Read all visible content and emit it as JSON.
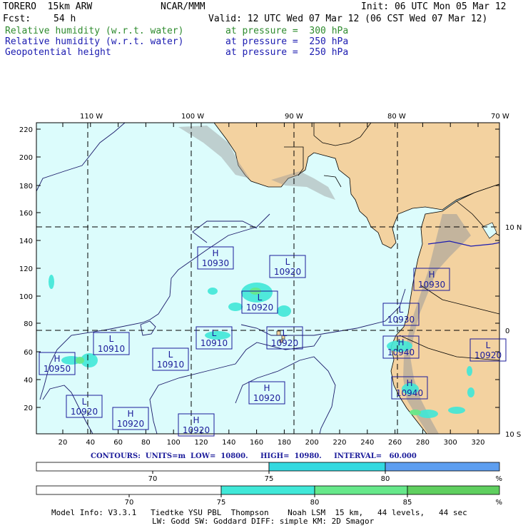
{
  "header": {
    "model": "TORERO  15km ARW",
    "center": "NCAR/MMM",
    "init": "Init: 06 UTC Mon 05 Mar 12",
    "fcst_label": "Fcst:",
    "fcst_value": "54 h",
    "valid": "Valid: 12 UTC Wed 07 Mar 12 (06 CST Wed 07 Mar 12)"
  },
  "fields": [
    {
      "name": "Relative humidity (w.r.t. water)",
      "level": "at pressure =  300 hPa",
      "color": "#2e8b2e"
    },
    {
      "name": "Relative humidity (w.r.t. water)",
      "level": "at pressure =  250 hPa",
      "color": "#1b1bb0"
    },
    {
      "name": "Geopotential height",
      "level": "at pressure =  250 hPa",
      "color": "#000000"
    }
  ],
  "map": {
    "top_lon_labels": [
      "110 W",
      "100 W",
      "90 W",
      "80 W",
      "70 W"
    ],
    "right_lat_labels": [
      "10 N",
      "0",
      "10 S"
    ],
    "y_ticks": [
      "220",
      "200",
      "180",
      "160",
      "140",
      "120",
      "100",
      "80",
      "60",
      "40",
      "20"
    ],
    "x_ticks": [
      "20",
      "40",
      "60",
      "80",
      "100",
      "120",
      "140",
      "160",
      "180",
      "200",
      "220",
      "240",
      "260",
      "280",
      "300",
      "320"
    ],
    "ocean_color": "#dcfcfc",
    "land_color": "#f3d2a0",
    "highs_lows": [
      {
        "type": "H",
        "value": "10930"
      },
      {
        "type": "L",
        "value": "10920"
      },
      {
        "type": "L",
        "value": "10920"
      },
      {
        "type": "H",
        "value": "10930"
      },
      {
        "type": "L",
        "value": "10930"
      },
      {
        "type": "L",
        "value": "10910"
      },
      {
        "type": "L",
        "value": "10910"
      },
      {
        "type": "L",
        "value": "10910"
      },
      {
        "type": "L",
        "value": "10920"
      },
      {
        "type": "H",
        "value": "10950"
      },
      {
        "type": "H",
        "value": "10940"
      },
      {
        "type": "L",
        "value": "10920"
      },
      {
        "type": "H",
        "value": "10920"
      },
      {
        "type": "H",
        "value": "10940"
      },
      {
        "type": "L",
        "value": "10920"
      },
      {
        "type": "H",
        "value": "10920"
      },
      {
        "type": "H",
        "value": "10920"
      }
    ]
  },
  "contours": "CONTOURS:  UNITS=m  LOW=  10800.     HIGH=  10980.     INTERVAL=   60.000",
  "colorbar1": {
    "labels": [
      "70",
      "75",
      "80"
    ],
    "unit": "%",
    "colors": [
      "#ffffff",
      "#33d9e0",
      "#5d9ef0"
    ]
  },
  "colorbar2": {
    "labels": [
      "70",
      "75",
      "80",
      "85"
    ],
    "unit": "%",
    "colors": [
      "#ffffff",
      "#40e8d8",
      "#66e88a",
      "#5fcf5f"
    ]
  },
  "footer": {
    "line1": "Model Info: V3.3.1   Tiedtke YSU PBL  Thompson    Noah LSM  15 km,   44 levels,   44 sec",
    "line2": "LW: Godd SW: Goddard DIFF: simple KM: 2D Smagor"
  }
}
